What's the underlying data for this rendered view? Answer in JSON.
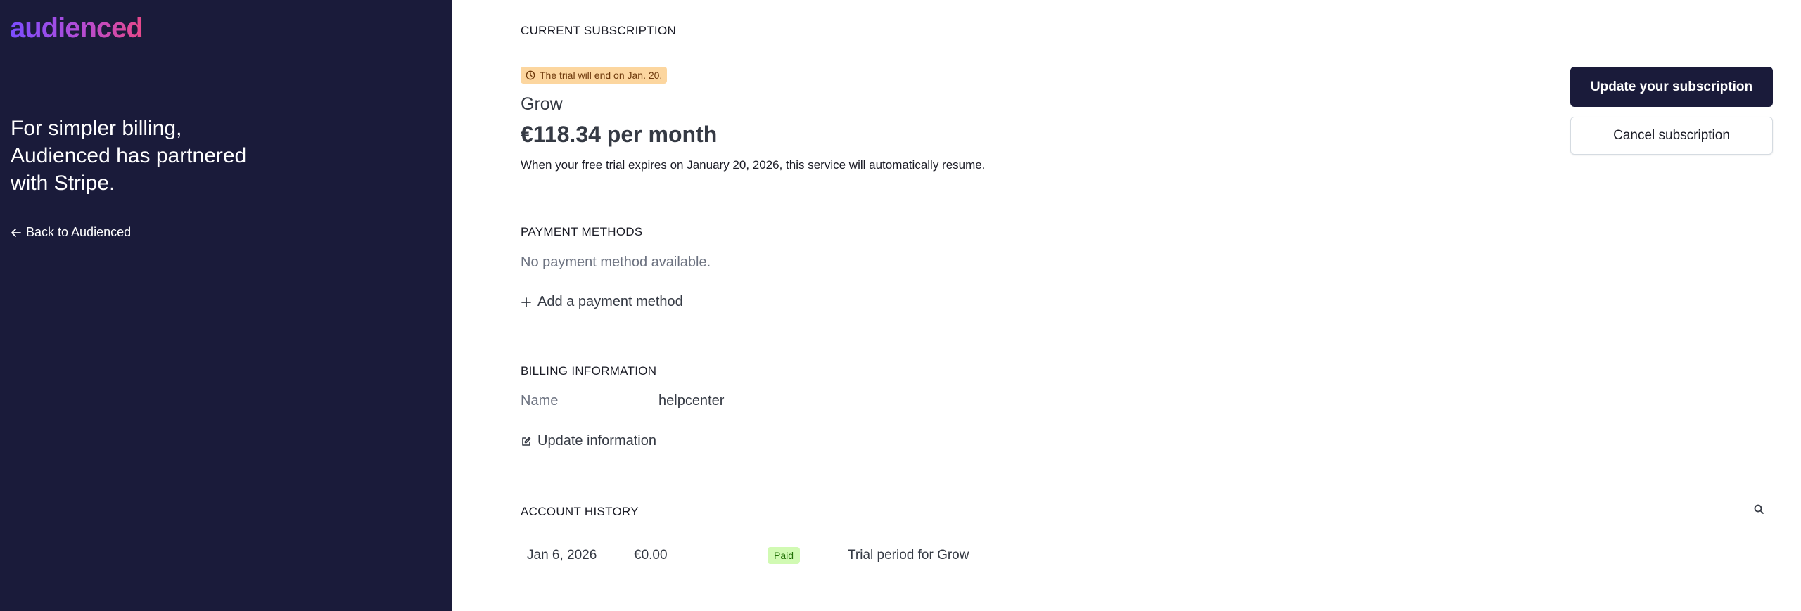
{
  "sidebar": {
    "logo": "audienced",
    "tagline": "For simpler billing, Audienced has partnered with Stripe.",
    "back_link": "Back to Audienced"
  },
  "subscription": {
    "section_title": "CURRENT SUBSCRIPTION",
    "trial_badge": "The trial will end on Jan. 20.",
    "plan_name": "Grow",
    "price": "€118.34 per month",
    "note": "When your free trial expires on January 20, 2026, this service will automatically resume.",
    "update_button": "Update your subscription",
    "cancel_button": "Cancel subscription"
  },
  "payment": {
    "section_title": "PAYMENT METHODS",
    "empty_text": "No payment method available.",
    "add_link": "Add a payment method"
  },
  "billing": {
    "section_title": "BILLING INFORMATION",
    "name_label": "Name",
    "name_value": "helpcenter",
    "update_link": "Update information"
  },
  "history": {
    "section_title": "ACCOUNT HISTORY",
    "rows": [
      {
        "date": "Jan 6, 2026",
        "amount": "€0.00",
        "status": "Paid",
        "description": "Trial period for Grow"
      }
    ]
  },
  "colors": {
    "sidebar_bg": "#1a1b3a",
    "primary_button": "#1a1b3a",
    "trial_badge_bg": "#fcd69f",
    "paid_badge_bg": "#d1fab3",
    "paid_badge_text": "#217005"
  }
}
